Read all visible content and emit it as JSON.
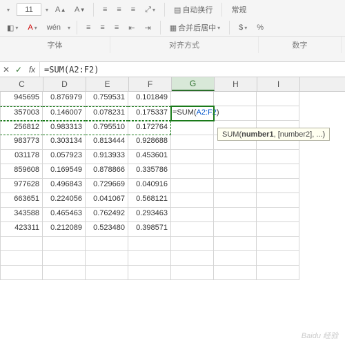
{
  "ribbon": {
    "font_size": "11",
    "wen": "wén",
    "wrap": "自动换行",
    "merge": "合并后居中",
    "format_group": "常规",
    "sec_font": "字体",
    "sec_align": "对齐方式",
    "sec_number": "数字"
  },
  "formula": "=SUM(A2:F2)",
  "columns": [
    "C",
    "D",
    "E",
    "F",
    "G",
    "H",
    "I"
  ],
  "rows": [
    [
      "945695",
      "0.876979",
      "0.759531",
      "0.101849",
      "",
      "",
      ""
    ],
    [
      "357003",
      "0.146007",
      "0.078231",
      "0.175337",
      "",
      "",
      ""
    ],
    [
      "256812",
      "0.983313",
      "0.795510",
      "0.172764",
      "",
      "",
      ""
    ],
    [
      "983773",
      "0.303134",
      "0.813444",
      "0.928688",
      "",
      "",
      ""
    ],
    [
      "031178",
      "0.057923",
      "0.913933",
      "0.453601",
      "",
      "",
      ""
    ],
    [
      "859608",
      "0.169549",
      "0.878866",
      "0.335786",
      "",
      "",
      ""
    ],
    [
      "977628",
      "0.496843",
      "0.729669",
      "0.040916",
      "",
      "",
      ""
    ],
    [
      "663651",
      "0.224056",
      "0.041067",
      "0.568121",
      "",
      "",
      ""
    ],
    [
      "343588",
      "0.465463",
      "0.762492",
      "0.293463",
      "",
      "",
      ""
    ],
    [
      "423311",
      "0.212089",
      "0.523480",
      "0.398571",
      "",
      "",
      ""
    ],
    [
      "",
      "",
      "",
      "",
      "",
      "",
      ""
    ],
    [
      "",
      "",
      "",
      "",
      "",
      "",
      ""
    ],
    [
      "",
      "",
      "",
      "",
      "",
      "",
      ""
    ]
  ],
  "active": {
    "prefix": "=SUM(",
    "ref": "A2:F2",
    "suffix": ")"
  },
  "tooltip": {
    "fn": "SUM(",
    "arg1": "number1",
    "rest": ", [number2], ...)"
  },
  "watermark": "Baidu 经验"
}
